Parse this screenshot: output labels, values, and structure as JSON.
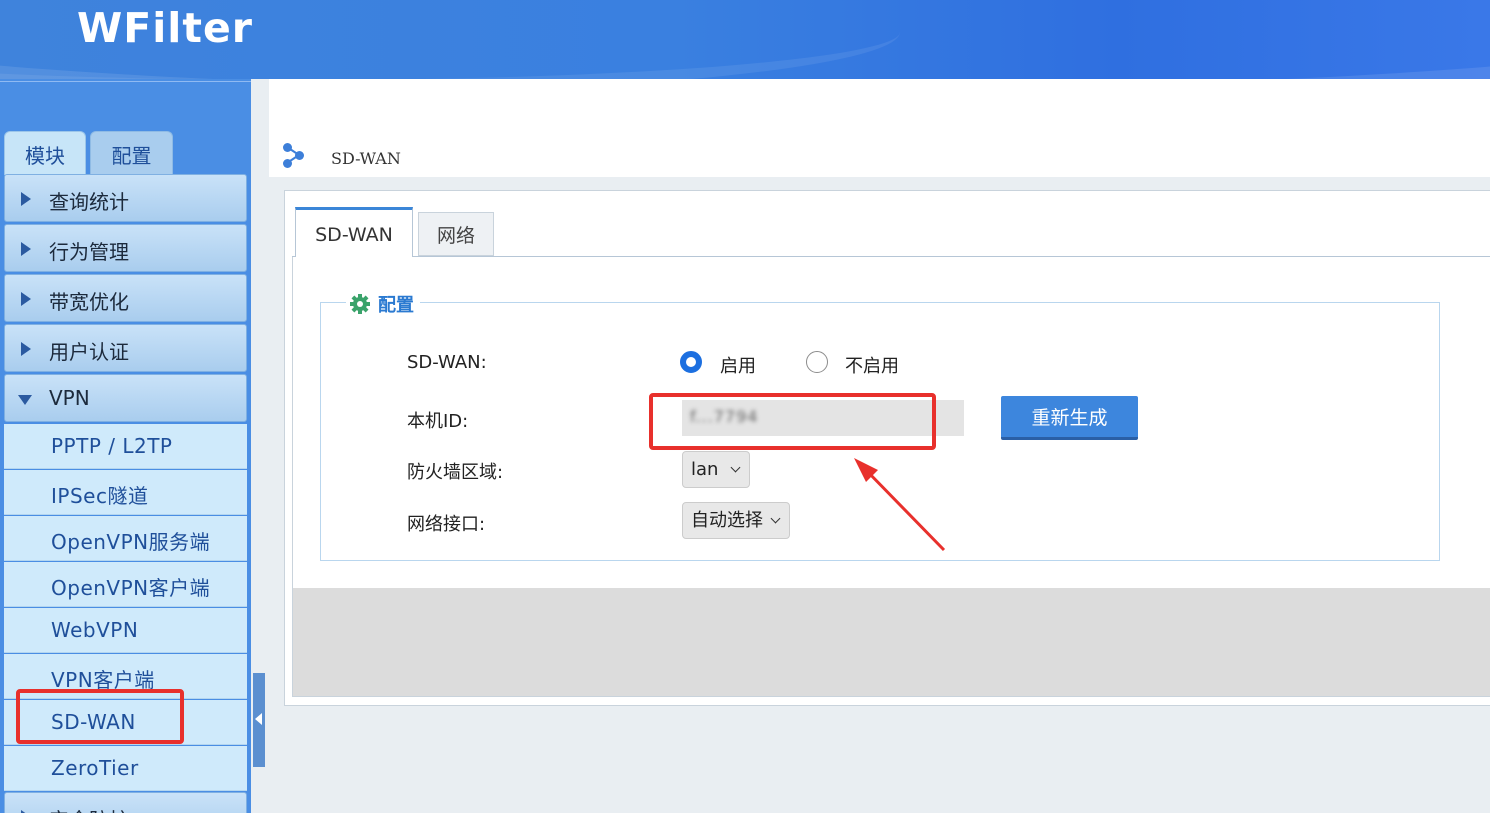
{
  "app": {
    "logo": "WFilter"
  },
  "sidebar": {
    "tabs": [
      {
        "label": "模块"
      },
      {
        "label": "配置"
      }
    ],
    "groups": [
      {
        "label": "查询统计"
      },
      {
        "label": "行为管理"
      },
      {
        "label": "带宽优化"
      },
      {
        "label": "用户认证"
      },
      {
        "label": "VPN"
      },
      {
        "label": "安全防护"
      }
    ],
    "vpn_items": [
      {
        "label": "PPTP / L2TP"
      },
      {
        "label": "IPSec隧道"
      },
      {
        "label": "OpenVPN服务端"
      },
      {
        "label": "OpenVPN客户端"
      },
      {
        "label": "WebVPN"
      },
      {
        "label": "VPN客户端"
      },
      {
        "label": "SD-WAN"
      },
      {
        "label": "ZeroTier"
      }
    ]
  },
  "breadcrumb": {
    "title": "SD-WAN"
  },
  "content": {
    "tabs": [
      {
        "label": "SD-WAN"
      },
      {
        "label": "网络"
      }
    ],
    "section_title": "配置",
    "fields": {
      "sdwan_label": "SD-WAN:",
      "enable_label": "启用",
      "disable_label": "不启用",
      "id_label": "本机ID:",
      "id_value": "f...7794",
      "regenerate_label": "重新生成",
      "zone_label": "防火墙区域:",
      "zone_value": "lan",
      "iface_label": "网络接口:",
      "iface_value": "自动选择"
    }
  },
  "colors": {
    "header": "#3a80e0",
    "annotation": "#e8302c",
    "accent": "#3d86dd"
  }
}
